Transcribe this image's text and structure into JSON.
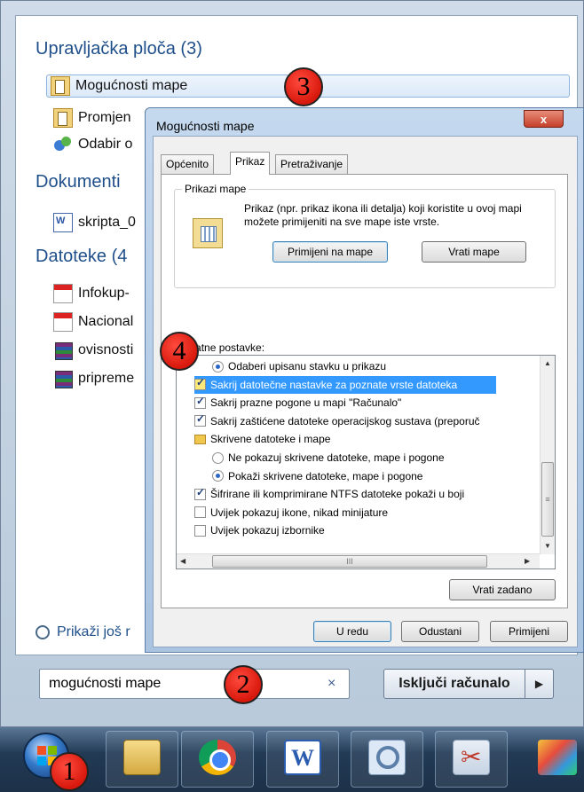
{
  "start_menu": {
    "control_panel": {
      "title": "Upravljačka ploča (3)",
      "items": [
        "Mogućnosti mape",
        "Promjen",
        "Odabir o"
      ]
    },
    "documents": {
      "title": "Dokumenti",
      "items": [
        "skripta_0"
      ]
    },
    "files": {
      "title": "Datoteke (4",
      "items": [
        "Infokup-",
        "Nacional",
        "ovisnosti",
        "pripreme"
      ]
    },
    "more_results": "Prikaži još r",
    "search": {
      "value": "mogućnosti mape",
      "clear_icon": "×"
    },
    "shutdown": {
      "label": "Isključi računalo",
      "arrow": "▶"
    }
  },
  "dialog": {
    "title": "Mogućnosti mape",
    "close_label": "x",
    "tabs": [
      "Općenito",
      "Prikaz",
      "Pretraživanje"
    ],
    "active_tab": "Prikaz",
    "folder_views": {
      "group_label": "Prikazi mape",
      "description": "Prikaz (npr. prikaz ikona ili detalja) koji koristite u ovoj mapi možete primijeniti na sve mape iste vrste.",
      "apply_button": "Primijeni na mape",
      "reset_button": "Vrati mape"
    },
    "advanced": {
      "label": "Dodatne postavke:",
      "rows": [
        {
          "kind": "radio",
          "checked": true,
          "indent": 2,
          "text": "Odaberi upisanu stavku u prikazu"
        },
        {
          "kind": "checkbox",
          "checked": true,
          "indent": 1,
          "text": "Sakrij datotečne nastavke za poznate vrste datoteka",
          "highlighted": true
        },
        {
          "kind": "checkbox",
          "checked": true,
          "indent": 1,
          "text": "Sakrij prazne pogone u mapi \"Računalo\""
        },
        {
          "kind": "checkbox",
          "checked": true,
          "indent": 1,
          "text": "Sakrij zaštićene datoteke operacijskog sustava (preporuč"
        },
        {
          "kind": "folder",
          "checked": false,
          "indent": 1,
          "text": "Skrivene datoteke i mape"
        },
        {
          "kind": "radio",
          "checked": false,
          "indent": 2,
          "text": "Ne pokazuj skrivene datoteke, mape i pogone"
        },
        {
          "kind": "radio",
          "checked": true,
          "indent": 2,
          "text": "Pokaži skrivene datoteke, mape i pogone"
        },
        {
          "kind": "checkbox",
          "checked": true,
          "indent": 1,
          "text": "Šifrirane ili komprimirane NTFS datoteke pokaži u boji"
        },
        {
          "kind": "checkbox",
          "checked": false,
          "indent": 1,
          "text": "Uvijek pokazuj ikone, nikad minijature"
        },
        {
          "kind": "checkbox",
          "checked": false,
          "indent": 1,
          "text": "Uvijek pokazuj izbornike"
        }
      ],
      "restore_defaults": "Vrati zadano",
      "scroll_grip": "≡",
      "hscroll_grip": "III"
    },
    "buttons": {
      "ok": "U redu",
      "cancel": "Odustani",
      "apply": "Primijeni"
    }
  },
  "callouts": [
    "1",
    "2",
    "3",
    "4"
  ],
  "taskbar": {
    "icons": [
      "start-orb",
      "windows-explorer-icon",
      "chrome-icon",
      "word-icon",
      "search-icon",
      "snipping-tool-icon",
      "paint-icon"
    ]
  },
  "colors": {
    "highlight": "#3399ff",
    "callout": "#d8180c",
    "link_blue": "#1f4f8a"
  }
}
